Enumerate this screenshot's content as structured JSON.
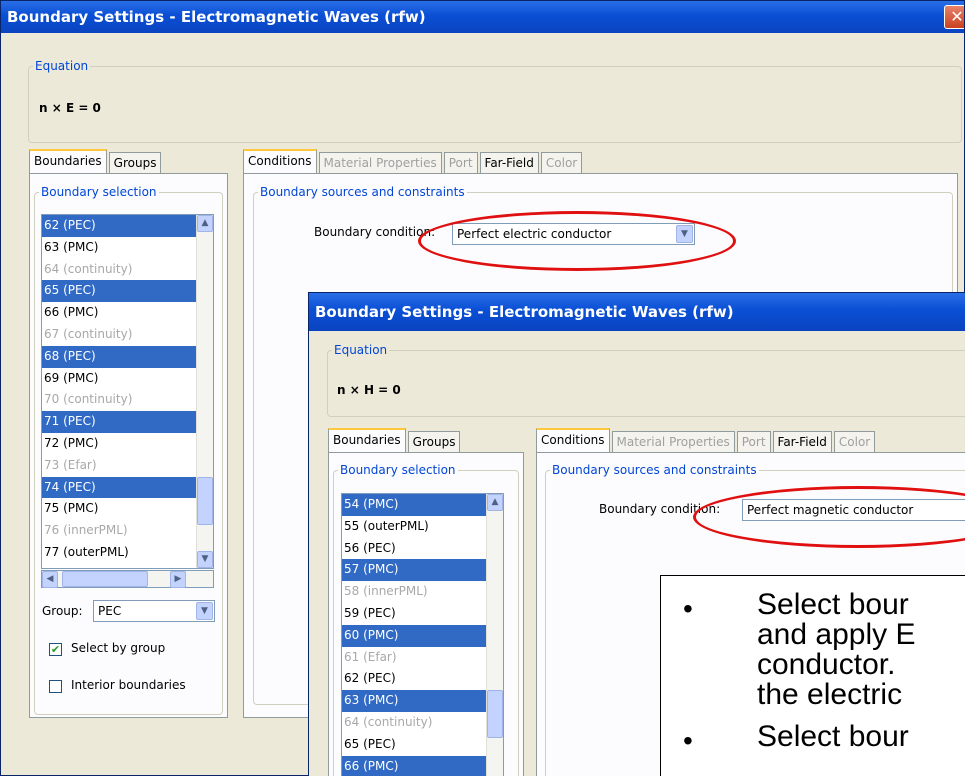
{
  "dialog1": {
    "title": "Boundary Settings - Electromagnetic Waves (rfw)",
    "close": "✕",
    "equation_legend": "Equation",
    "equation": "n × E = 0",
    "left_tabs": [
      "Boundaries",
      "Groups"
    ],
    "selection_legend": "Boundary selection",
    "items": [
      {
        "label": "62 (PEC)",
        "state": "sel"
      },
      {
        "label": "63 (PMC)",
        "state": "normal"
      },
      {
        "label": "64 (continuity)",
        "state": "dim"
      },
      {
        "label": "65 (PEC)",
        "state": "sel"
      },
      {
        "label": "66 (PMC)",
        "state": "normal"
      },
      {
        "label": "67 (continuity)",
        "state": "dim"
      },
      {
        "label": "68 (PEC)",
        "state": "sel"
      },
      {
        "label": "69 (PMC)",
        "state": "normal"
      },
      {
        "label": "70 (continuity)",
        "state": "dim"
      },
      {
        "label": "71 (PEC)",
        "state": "sel"
      },
      {
        "label": "72 (PMC)",
        "state": "normal"
      },
      {
        "label": "73 (Efar)",
        "state": "dim"
      },
      {
        "label": "74 (PEC)",
        "state": "sel"
      },
      {
        "label": "75 (PMC)",
        "state": "normal"
      },
      {
        "label": "76 (innerPML)",
        "state": "dim"
      },
      {
        "label": "77 (outerPML)",
        "state": "normal"
      }
    ],
    "group_label": "Group:",
    "group_value": "PEC",
    "select_by_group": "Select by group",
    "select_by_group_checked": true,
    "interior_boundaries": "Interior boundaries",
    "right_tabs": [
      {
        "label": "Conditions",
        "state": "active"
      },
      {
        "label": "Material Properties",
        "state": "disabled"
      },
      {
        "label": "Port",
        "state": "disabled"
      },
      {
        "label": "Far-Field",
        "state": "normal"
      },
      {
        "label": "Color",
        "state": "disabled"
      }
    ],
    "sources_legend": "Boundary sources and constraints",
    "condition_label": "Boundary condition:",
    "condition_value": "Perfect electric conductor"
  },
  "dialog2": {
    "title": "Boundary Settings - Electromagnetic Waves (rfw)",
    "equation_legend": "Equation",
    "equation": "n × H = 0",
    "left_tabs": [
      "Boundaries",
      "Groups"
    ],
    "selection_legend": "Boundary selection",
    "items": [
      {
        "label": "54 (PMC)",
        "state": "sel"
      },
      {
        "label": "55 (outerPML)",
        "state": "normal"
      },
      {
        "label": "56 (PEC)",
        "state": "normal"
      },
      {
        "label": "57 (PMC)",
        "state": "sel"
      },
      {
        "label": "58 (innerPML)",
        "state": "dim"
      },
      {
        "label": "59 (PEC)",
        "state": "normal"
      },
      {
        "label": "60 (PMC)",
        "state": "sel"
      },
      {
        "label": "61 (Efar)",
        "state": "dim"
      },
      {
        "label": "62 (PEC)",
        "state": "normal"
      },
      {
        "label": "63 (PMC)",
        "state": "sel"
      },
      {
        "label": "64 (continuity)",
        "state": "dim"
      },
      {
        "label": "65 (PEC)",
        "state": "normal"
      },
      {
        "label": "66 (PMC)",
        "state": "sel"
      }
    ],
    "right_tabs": [
      {
        "label": "Conditions",
        "state": "active"
      },
      {
        "label": "Material Properties",
        "state": "disabled"
      },
      {
        "label": "Port",
        "state": "disabled"
      },
      {
        "label": "Far-Field",
        "state": "normal"
      },
      {
        "label": "Color",
        "state": "disabled"
      }
    ],
    "sources_legend": "Boundary sources and constraints",
    "condition_label": "Boundary condition:",
    "condition_value": "Perfect magnetic conductor"
  },
  "note": {
    "bullet": "•",
    "lines": [
      "Select bour",
      "and apply E",
      "conductor.",
      "the electric",
      "Select bour"
    ]
  },
  "colors": {
    "highlight": "#e01010",
    "selection": "#316ac5",
    "titlebar": "#0a4fd4"
  }
}
